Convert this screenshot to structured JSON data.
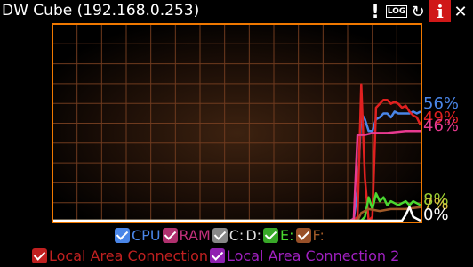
{
  "window": {
    "title": "DW Cube (192.168.0.253)"
  },
  "toolbar": {
    "alert_glyph": "!",
    "log_label": "LOG",
    "refresh_glyph": "↻",
    "info_glyph": "i",
    "close_glyph": "✕"
  },
  "colors": {
    "frame": "#f07800",
    "grid": "#6e3a1e",
    "cpu": "#4a86e8",
    "ram": "#c0307a",
    "drive_c": "#ffffff",
    "drive_d": "#dddddd",
    "drive_e": "#4ad830",
    "drive_f": "#a05a28",
    "lan1": "#e02020",
    "lan2": "#a020c0"
  },
  "legend": {
    "row1": [
      {
        "key": "cpu",
        "label": "CPU",
        "checked": true,
        "box_color": "#4a86e8",
        "text_color": "#4a86e8"
      },
      {
        "key": "ram",
        "label": "RAM",
        "checked": true,
        "box_color": "#b0306e",
        "text_color": "#c0307a"
      },
      {
        "key": "drive_c",
        "label": "C:",
        "checked": true,
        "box_color": "#888888",
        "text_color": "#dddddd"
      },
      {
        "key": "drive_d",
        "label": "D:",
        "checked": null,
        "box_color": "",
        "text_color": "#dddddd"
      },
      {
        "key": "drive_e",
        "label": "E:",
        "checked": true,
        "box_color": "#38a828",
        "text_color": "#4ad830"
      },
      {
        "key": "drive_f",
        "label": "F:",
        "checked": true,
        "box_color": "#985028",
        "text_color": "#a05a28"
      }
    ],
    "row2": [
      {
        "key": "lan1",
        "label": "Local Area Connection",
        "checked": true,
        "box_color": "#c02020",
        "text_color": "#c02020"
      },
      {
        "key": "lan2",
        "label": "Local Area Connection 2",
        "checked": true,
        "box_color": "#9020b0",
        "text_color": "#a020c0"
      }
    ]
  },
  "readouts": [
    {
      "key": "cpu",
      "text": "56%",
      "color": "#4a86e8"
    },
    {
      "key": "lan1",
      "text": "49%",
      "color": "#e02020"
    },
    {
      "key": "ram",
      "text": "46%",
      "color": "#e83a90"
    },
    {
      "key": "drive_e",
      "text": "8%",
      "color": "#9acd32"
    },
    {
      "key": "drive_f",
      "text": "7%",
      "color": "#d8c040"
    },
    {
      "key": "drive_c",
      "text": "0%",
      "color": "#ffffff"
    }
  ],
  "chart_data": {
    "type": "line",
    "ylim": [
      0,
      100
    ],
    "grid": true,
    "samples": 100,
    "series": [
      {
        "name": "CPU",
        "color": "#4a86e8",
        "values": [
          [
            0,
            0
          ],
          [
            80,
            0
          ],
          [
            81,
            1
          ],
          [
            82,
            15
          ],
          [
            83,
            55
          ],
          [
            84,
            52
          ],
          [
            85,
            46
          ],
          [
            86,
            46
          ],
          [
            87,
            52
          ],
          [
            88,
            53
          ],
          [
            89,
            55
          ],
          [
            90,
            55
          ],
          [
            91,
            53
          ],
          [
            92,
            56
          ],
          [
            93,
            55
          ],
          [
            94,
            55
          ],
          [
            95,
            55
          ],
          [
            96,
            55
          ],
          [
            97,
            56
          ],
          [
            98,
            55
          ],
          [
            99,
            56
          ]
        ]
      },
      {
        "name": "Local Area Connection",
        "color": "#e02020",
        "values": [
          [
            0,
            0
          ],
          [
            81,
            0
          ],
          [
            82,
            2
          ],
          [
            83,
            70
          ],
          [
            84,
            22
          ],
          [
            85,
            0
          ],
          [
            86,
            2
          ],
          [
            87,
            58
          ],
          [
            88,
            60
          ],
          [
            89,
            62
          ],
          [
            90,
            62
          ],
          [
            91,
            60
          ],
          [
            92,
            61
          ],
          [
            93,
            60
          ],
          [
            94,
            58
          ],
          [
            95,
            59
          ],
          [
            96,
            56
          ],
          [
            97,
            54
          ],
          [
            98,
            53
          ],
          [
            99,
            49
          ]
        ]
      },
      {
        "name": "RAM",
        "color": "#e83a90",
        "values": [
          [
            0,
            0
          ],
          [
            80,
            0
          ],
          [
            81,
            1
          ],
          [
            82,
            44
          ],
          [
            84,
            44
          ],
          [
            86,
            45
          ],
          [
            90,
            45
          ],
          [
            95,
            46
          ],
          [
            99,
            46
          ]
        ]
      },
      {
        "name": "E:",
        "color": "#4ad830",
        "values": [
          [
            0,
            0
          ],
          [
            83,
            0
          ],
          [
            84,
            2
          ],
          [
            85,
            12
          ],
          [
            86,
            6
          ],
          [
            87,
            14
          ],
          [
            88,
            10
          ],
          [
            89,
            12
          ],
          [
            90,
            8
          ],
          [
            91,
            10
          ],
          [
            92,
            9
          ],
          [
            93,
            8
          ],
          [
            94,
            9
          ],
          [
            95,
            10
          ],
          [
            96,
            8
          ],
          [
            97,
            10
          ],
          [
            98,
            9
          ],
          [
            99,
            8
          ]
        ]
      },
      {
        "name": "F:",
        "color": "#a05a28",
        "values": [
          [
            0,
            0
          ],
          [
            82,
            0
          ],
          [
            83,
            4
          ],
          [
            85,
            6
          ],
          [
            88,
            5
          ],
          [
            91,
            6
          ],
          [
            95,
            6
          ],
          [
            99,
            7
          ]
        ]
      },
      {
        "name": "C:",
        "color": "#ffffff",
        "values": [
          [
            0,
            0
          ],
          [
            94,
            0
          ],
          [
            95,
            3
          ],
          [
            96,
            7
          ],
          [
            97,
            2
          ],
          [
            98,
            1
          ],
          [
            99,
            0
          ]
        ]
      }
    ]
  }
}
